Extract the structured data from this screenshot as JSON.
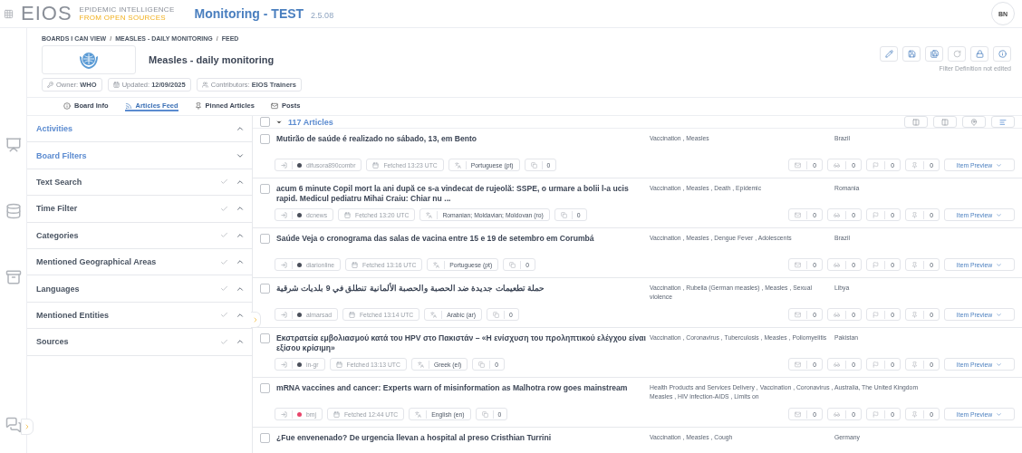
{
  "header": {
    "logo_main": "EIOS",
    "logo_line1": "EPIDEMIC INTELLIGENCE",
    "logo_line2": "FROM OPEN SOURCES",
    "app_title": "Monitoring - TEST",
    "version": "2.5.08",
    "avatar": "BN"
  },
  "board": {
    "separator": "/",
    "breadcrumb": [
      "BOARDS I CAN VIEW",
      "MEASLES - DAILY MONITORING",
      "FEED"
    ],
    "title": "Measles - daily monitoring",
    "chips": [
      {
        "label": "Owner:",
        "value": "WHO",
        "kind": "owner"
      },
      {
        "label": "Updated:",
        "value": "12/09/2025",
        "kind": "updated"
      },
      {
        "label": "Contributors:",
        "value": "EIOS Trainers",
        "kind": "contributors"
      }
    ],
    "status": "Filter Definition not edited"
  },
  "tabs": [
    {
      "label": "Board Info",
      "kind": "info",
      "selected": false
    },
    {
      "label": "Articles Feed",
      "kind": "feed",
      "selected": true
    },
    {
      "label": "Pinned Articles",
      "kind": "pinned",
      "selected": false
    },
    {
      "label": "Posts",
      "kind": "posts",
      "selected": false
    }
  ],
  "filters": [
    {
      "label": "Activities",
      "kind": "section",
      "checked": false,
      "expanded": true
    },
    {
      "label": "Board Filters",
      "kind": "section",
      "checked": false,
      "expanded": false
    },
    {
      "label": "Text Search",
      "kind": "filter",
      "checked": true,
      "expanded": true
    },
    {
      "label": "Time Filter",
      "kind": "filter",
      "checked": true,
      "expanded": true
    },
    {
      "label": "Categories",
      "kind": "filter",
      "checked": true,
      "expanded": true
    },
    {
      "label": "Mentioned Geographical Areas",
      "kind": "filter",
      "checked": true,
      "expanded": true
    },
    {
      "label": "Languages",
      "kind": "filter",
      "checked": true,
      "expanded": true
    },
    {
      "label": "Mentioned Entities",
      "kind": "filter",
      "checked": true,
      "expanded": true
    },
    {
      "label": "Sources",
      "kind": "filter",
      "checked": true,
      "expanded": true
    }
  ],
  "list": {
    "count": "117 Articles",
    "checked": false,
    "views": [
      {
        "selected": false
      },
      {
        "selected": false
      },
      {
        "selected": false
      },
      {
        "selected": true
      }
    ]
  },
  "articles": [
    {
      "checked": false,
      "title": "Mutirão de saúde é realizado no sábado, 13, em Bento",
      "categories": "Vaccination , Measles",
      "location": "Brazil",
      "source": "difusora890combr",
      "color": "#4a4f5a",
      "fetched": "Fetched 13:23 UTC",
      "language": "Portuguese (pt)",
      "duplicates": "0",
      "counts": [
        "0",
        "0",
        "0",
        "0"
      ],
      "preview": "Item Preview"
    },
    {
      "checked": false,
      "title": "acum 6 minute Copil mort la ani după ce s-a vindecat de rujeolă: SSPE, o urmare a bolii l-a ucis rapid. Medicul pediatru Mihai Craiu: Chiar nu ...",
      "categories": "Vaccination , Measles , Death , Epidemic",
      "location": "Romania",
      "source": "dcnews",
      "color": "#4a4f5a",
      "fetched": "Fetched 13:20 UTC",
      "language": "Romanian; Moldavian; Moldovan (ro)",
      "duplicates": "0",
      "counts": [
        "0",
        "0",
        "0",
        "0"
      ],
      "preview": "Item Preview"
    },
    {
      "checked": false,
      "title": "Saúde Veja o cronograma das salas de vacina entre 15 e 19 de setembro em Corumbá",
      "categories": "Vaccination , Measles , Dengue Fever , Adolescents",
      "location": "Brazil",
      "source": "diarionline",
      "color": "#4a4f5a",
      "fetched": "Fetched 13:16 UTC",
      "language": "Portuguese (pt)",
      "duplicates": "0",
      "counts": [
        "0",
        "0",
        "0",
        "0"
      ],
      "preview": "Item Preview"
    },
    {
      "checked": false,
      "title": "حملة تطعيمات جديدة ضد الحصبة والحصبة الألمانية تنطلق في 9 بلديات شرقية",
      "categories": "Vaccination , Rubella (German measles) , Measles , Sexual violence",
      "location": "Libya",
      "source": "almarsad",
      "color": "#4a4f5a",
      "fetched": "Fetched 13:14 UTC",
      "language": "Arabic (ar)",
      "duplicates": "0",
      "counts": [
        "0",
        "0",
        "0",
        "0"
      ],
      "preview": "Item Preview"
    },
    {
      "checked": false,
      "title": "Εκστρατεία εμβολιασμού κατά του HPV στο Πακιστάν – «Η ενίσχυση του προληπτικού ελέγχου είναι εξίσου κρίσιμη»",
      "categories": "Vaccination , Coronavirus , Tuberculosis , Measles , Poliomyelitis",
      "location": "Pakistan",
      "source": "in-gr",
      "color": "#4a4f5a",
      "fetched": "Fetched 13:13 UTC",
      "language": "Greek (el)",
      "duplicates": "0",
      "counts": [
        "0",
        "0",
        "0",
        "0"
      ],
      "preview": "Item Preview"
    },
    {
      "checked": false,
      "title": "mRNA vaccines and cancer: Experts warn of misinformation as Malhotra row goes mainstream",
      "categories": "Health Products and Services Delivery , Vaccination , Coronavirus , Measles , HIV infection-AIDS , Limits on",
      "location": "Australia, The United Kingdom",
      "source": "bmj",
      "color": "#e8456b",
      "fetched": "Fetched 12:44 UTC",
      "language": "English (en)",
      "duplicates": "0",
      "counts": [
        "0",
        "0",
        "0",
        "0"
      ],
      "preview": "Item Preview"
    },
    {
      "checked": false,
      "title": "¿Fue envenenado? De urgencia llevan a hospital al preso Cristhian Turrini",
      "categories": "Vaccination , Measles , Cough",
      "location": "Germany"
    }
  ]
}
